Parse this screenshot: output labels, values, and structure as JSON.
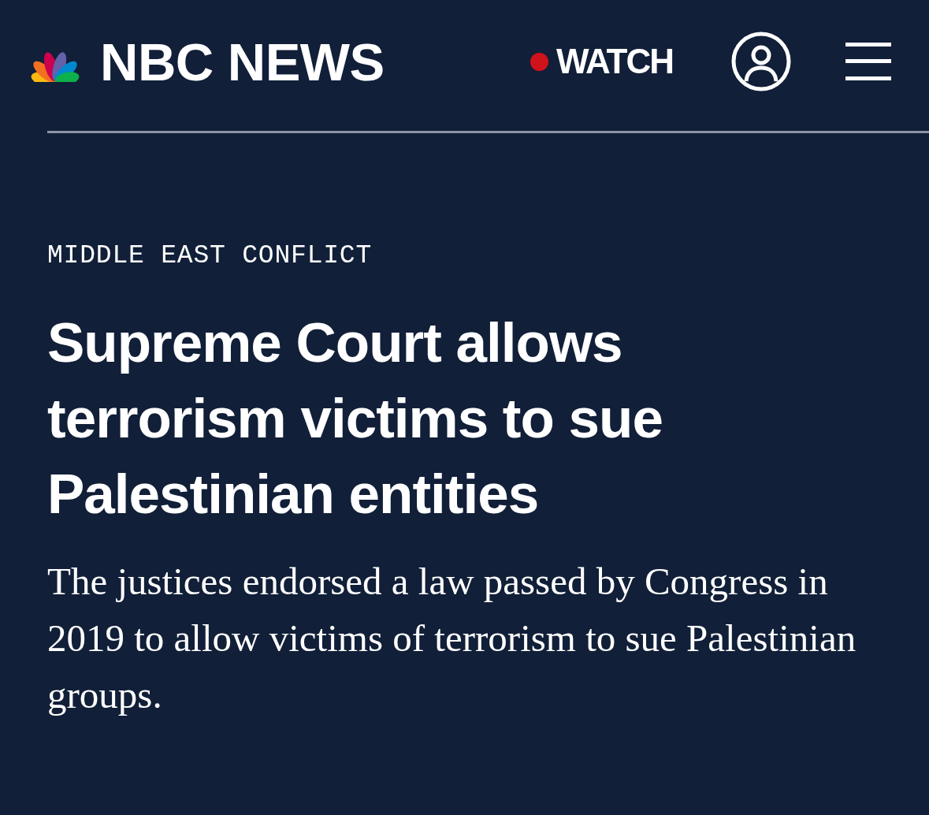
{
  "header": {
    "wordmark": "NBC NEWS",
    "watch": {
      "label": "WATCH",
      "live": true
    }
  },
  "article": {
    "section": "MIDDLE EAST CONFLICT",
    "headline": "Supreme Court allows terrorism victims to sue Palestinian entities",
    "dek": "The justices endorsed a law passed by Congress in 2019 to allow victims of terrorism to sue Palestinian groups."
  }
}
